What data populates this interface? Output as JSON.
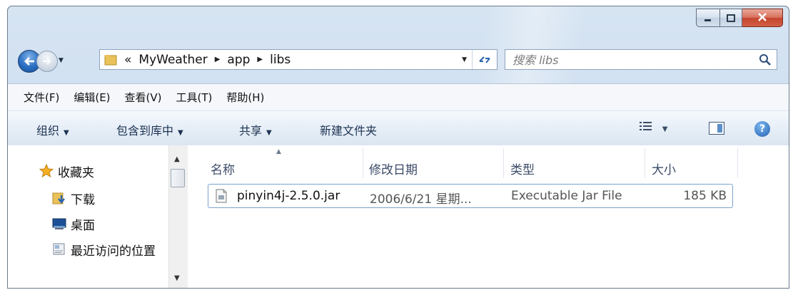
{
  "window": {
    "caption_buttons": {
      "minimize_icon": "minimize-icon",
      "maximize_icon": "maximize-icon",
      "close_icon": "close-icon"
    }
  },
  "nav": {
    "address": {
      "overflow": "«",
      "crumbs": [
        "MyWeather",
        "app",
        "libs"
      ]
    },
    "search": {
      "placeholder": "搜索 libs"
    }
  },
  "menubar": {
    "items": [
      "文件(F)",
      "编辑(E)",
      "查看(V)",
      "工具(T)",
      "帮助(H)"
    ]
  },
  "cmdbar": {
    "items": [
      "组织",
      "包含到库中",
      "共享",
      "新建文件夹"
    ]
  },
  "navpane": {
    "items": [
      {
        "label": "收藏夹",
        "icon": "star-icon"
      },
      {
        "label": "下载",
        "icon": "downloads-folder-icon"
      },
      {
        "label": "桌面",
        "icon": "desktop-icon"
      },
      {
        "label": "最近访问的位置",
        "icon": "recent-places-icon"
      }
    ]
  },
  "files": {
    "columns": [
      "名称",
      "修改日期",
      "类型",
      "大小"
    ],
    "rows": [
      {
        "name": "pinyin4j-2.5.0.jar",
        "modified": "2006/6/21 星期...",
        "type": "Executable Jar File",
        "size": "185 KB"
      }
    ]
  },
  "colors": {
    "window_frame": "#cfdff0",
    "close": "#c4452e",
    "selection_border": "#7da2ce"
  }
}
